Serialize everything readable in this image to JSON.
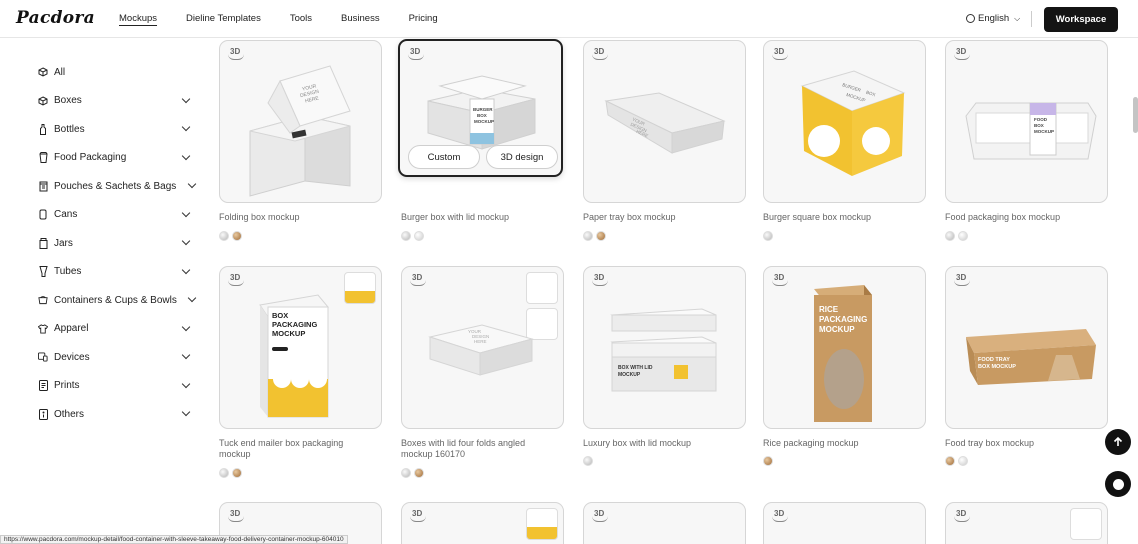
{
  "header": {
    "logo": "Pacdora",
    "nav": [
      "Mockups",
      "Dieline Templates",
      "Tools",
      "Business",
      "Pricing"
    ],
    "language": "English",
    "workspace": "Workspace"
  },
  "sidebar": {
    "items": [
      {
        "label": "All",
        "icon": "cube-icon"
      },
      {
        "label": "Boxes",
        "icon": "box-icon"
      },
      {
        "label": "Bottles",
        "icon": "bottle-icon"
      },
      {
        "label": "Food Packaging",
        "icon": "food-icon"
      },
      {
        "label": "Pouches & Sachets & Bags",
        "icon": "pouch-icon"
      },
      {
        "label": "Cans",
        "icon": "can-icon"
      },
      {
        "label": "Jars",
        "icon": "jar-icon"
      },
      {
        "label": "Tubes",
        "icon": "tube-icon"
      },
      {
        "label": "Containers & Cups & Bowls",
        "icon": "container-icon"
      },
      {
        "label": "Apparel",
        "icon": "apparel-icon"
      },
      {
        "label": "Devices",
        "icon": "device-icon"
      },
      {
        "label": "Prints",
        "icon": "print-icon"
      },
      {
        "label": "Others",
        "icon": "other-icon"
      }
    ]
  },
  "badge": "3D",
  "hover_buttons": {
    "custom": "Custom",
    "design": "3D design"
  },
  "products_row1": [
    {
      "caption": "Folding box mockup",
      "swatches": [
        "silver",
        "brown"
      ],
      "art": {
        "l1": "YOUR",
        "l2": "DESIGN",
        "l3": "HERE"
      }
    },
    {
      "caption": "Burger box with lid mockup",
      "swatches": [
        "silver",
        "white"
      ],
      "art": {
        "l1": "BURGER",
        "l2": "BOX",
        "l3": "MOCKUP"
      }
    },
    {
      "caption": "Paper tray box mockup",
      "swatches": [
        "silver",
        "brown"
      ],
      "art": {
        "l1": "YOUR",
        "l2": "DESIGN",
        "l3": "HERE"
      }
    },
    {
      "caption": "Burger square box mockup",
      "swatches": [
        "silver"
      ],
      "art": {
        "l1": "BURGER",
        "l2": "BOX",
        "l3": "MOCKUP"
      }
    },
    {
      "caption": "Food packaging box mockup",
      "swatches": [
        "silver",
        "white"
      ],
      "art": {
        "l1": "FOOD",
        "l2": "BOX",
        "l3": "MOCKUP"
      }
    }
  ],
  "products_row2": [
    {
      "caption": "Tuck end mailer box packaging mockup",
      "swatches": [
        "silver",
        "brown"
      ],
      "art": {
        "l1": "BOX",
        "l2": "PACKAGING",
        "l3": "MOCKUP"
      }
    },
    {
      "caption": "Boxes with lid four folds angled mockup 160170",
      "swatches": [
        "silver",
        "brown"
      ],
      "art": {
        "l1": "YOUR",
        "l2": "DESIGN",
        "l3": "HERE"
      }
    },
    {
      "caption": "Luxury box with lid mockup",
      "swatches": [
        "silver"
      ],
      "art": {
        "l1": "BOX WITH LID",
        "l2": "MOCKUP",
        "l3": ""
      }
    },
    {
      "caption": "Rice packaging mockup",
      "swatches": [
        "brown"
      ],
      "art": {
        "l1": "RICE",
        "l2": "PACKAGING",
        "l3": "MOCKUP"
      }
    },
    {
      "caption": "Food tray box mockup",
      "swatches": [
        "brown",
        "white"
      ],
      "art": {
        "l1": "FOOD TRAY",
        "l2": "BOX MOCKUP",
        "l3": ""
      }
    }
  ],
  "status_url": "https://www.pacdora.com/mockup-detail/food-container-with-sleeve-takeaway-food-delivery-container-mockup-604010",
  "colors": {
    "accent": "#141414",
    "yellow": "#f2c230",
    "kraft": "#c89a62"
  }
}
